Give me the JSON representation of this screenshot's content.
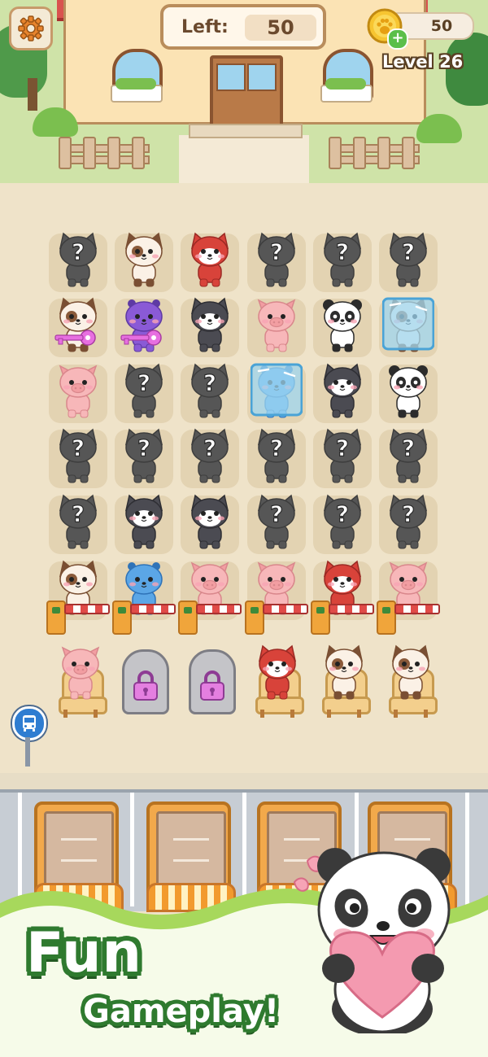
{
  "hud": {
    "left_label": "Left:",
    "left_value": "50",
    "coins": "50",
    "level": "Level 26",
    "settings_icon": "gear-icon",
    "coin_icon": "paw-coin-icon",
    "add_coins_icon": "plus-icon"
  },
  "board": {
    "columns": 6,
    "rows": [
      [
        "hidden",
        "siamese-cat",
        "fox",
        "hidden",
        "hidden",
        "hidden"
      ],
      [
        "siamese-cat-with-key",
        "purple-hippo-with-key",
        "husky",
        "pig",
        "panda",
        "frozen-siamese-cat"
      ],
      [
        "pig",
        "hidden",
        "hidden",
        "frozen-blue-hippo",
        "husky",
        "panda"
      ],
      [
        "hidden",
        "hidden",
        "hidden",
        "hidden",
        "hidden",
        "hidden"
      ],
      [
        "hidden",
        "husky",
        "husky",
        "hidden",
        "hidden",
        "hidden"
      ],
      [
        "siamese-cat",
        "blue-hippo",
        "pig",
        "pig",
        "fox",
        "pig"
      ]
    ],
    "gated_row_index": 5
  },
  "waiting_seats": [
    "pig",
    "locked",
    "locked",
    "fox",
    "siamese-cat",
    "siamese-cat"
  ],
  "bus_stop_icon": "bus-icon",
  "buses": 4,
  "banner": {
    "line1": "Fun",
    "line2": "Gameplay!",
    "mascot": "panda-with-heart"
  },
  "colors": {
    "accent_green": "#2f7a2f",
    "board_bg": "#efe3c9",
    "tile": "#e3d3b2",
    "key_pink": "#e76fe0"
  }
}
